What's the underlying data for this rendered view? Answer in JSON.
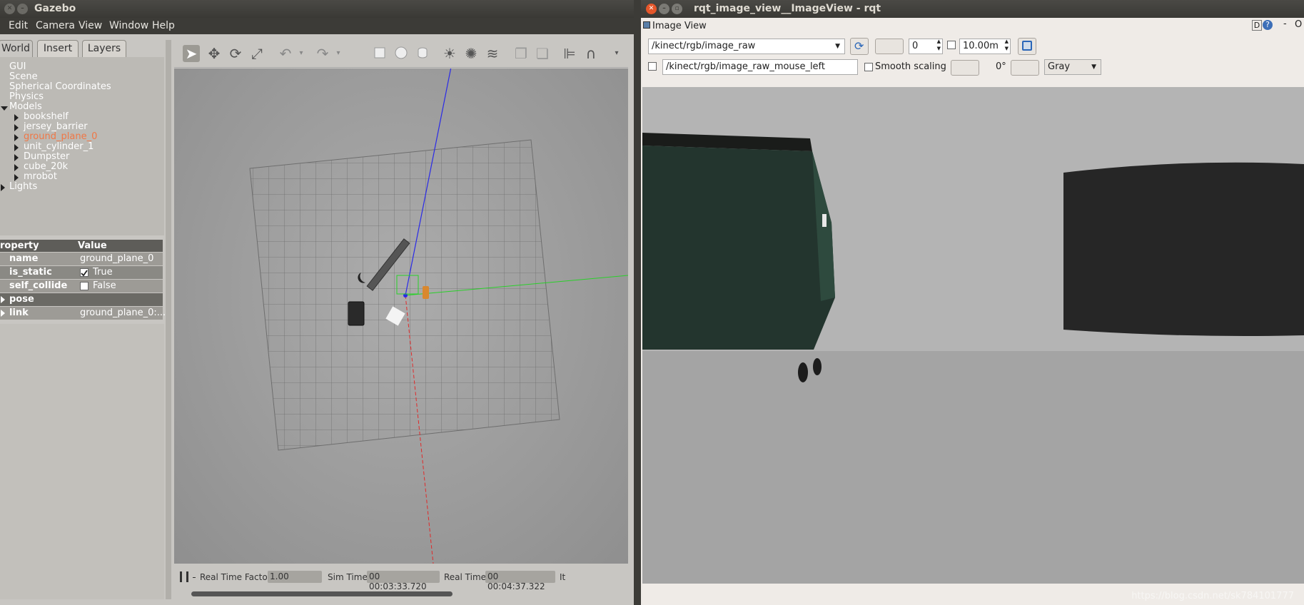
{
  "gazebo": {
    "title": "Gazebo",
    "menu": [
      "Edit",
      "Camera",
      "View",
      "Window",
      "Help"
    ],
    "tabs": [
      "World",
      "Insert",
      "Layers"
    ],
    "tree": {
      "top": [
        "GUI",
        "Scene",
        "Spherical Coordinates",
        "Physics"
      ],
      "models_label": "Models",
      "models": [
        "bookshelf",
        "jersey_barrier",
        "ground_plane_0",
        "unit_cylinder_1",
        "Dumpster",
        "cube_20k",
        "mrobot"
      ],
      "lights_label": "Lights"
    },
    "props": {
      "header": {
        "property": "roperty",
        "value": "Value"
      },
      "rows": [
        {
          "k": "name",
          "v": "ground_plane_0"
        },
        {
          "k": "is_static",
          "v": "True"
        },
        {
          "k": "self_collide",
          "v": "False"
        },
        {
          "k": "pose",
          "v": ""
        },
        {
          "k": "link",
          "v": "ground_plane_0:..."
        }
      ]
    },
    "status": {
      "rtf_label": "Real Time Factor:",
      "rtf": "1.00",
      "sim_label": "Sim Time:",
      "sim": "00 00:03:33.720",
      "real_label": "Real Time:",
      "real": "00 00:04:37.322",
      "it": "It"
    },
    "colors": {
      "selected_model": "#f07746",
      "axis_x": "#e02020",
      "axis_y": "#20c020",
      "axis_z": "#2020e0"
    }
  },
  "rqt": {
    "title": "rqt_image_view__ImageView - rqt",
    "panel_title": "Image View",
    "dock_btns": [
      "D",
      "-",
      "O"
    ],
    "topic": "/kinect/rgb/image_raw",
    "num": "0",
    "range": "10.00m",
    "mouse_topic": "/kinect/rgb/image_raw_mouse_left",
    "smooth_label": "Smooth scaling",
    "rotation": "0°",
    "colormap": "Gray"
  },
  "watermark": "https://blog.csdn.net/sk784101777"
}
